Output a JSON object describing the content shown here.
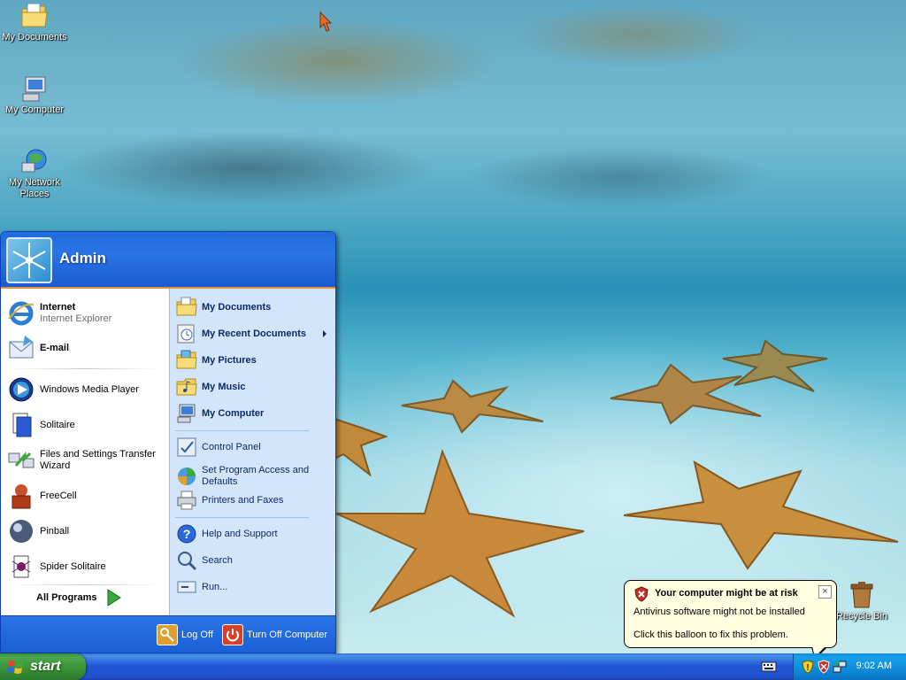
{
  "desktop": {
    "icons": [
      {
        "label": "My Documents",
        "icon": "folder-documents-icon"
      },
      {
        "label": "My Computer",
        "icon": "computer-icon"
      },
      {
        "label": "My Network Places",
        "icon": "network-places-icon"
      },
      {
        "label": "Recycle Bin",
        "icon": "recycle-bin-icon"
      }
    ]
  },
  "start_menu": {
    "username": "Admin",
    "pinned": [
      {
        "title": "Internet",
        "subtitle": "Internet Explorer",
        "icon": "internet-explorer-icon"
      },
      {
        "title": "E-mail",
        "subtitle": "",
        "icon": "email-icon"
      }
    ],
    "recent": [
      {
        "label": "Windows Media Player",
        "icon": "media-player-icon"
      },
      {
        "label": "Solitaire",
        "icon": "solitaire-icon"
      },
      {
        "label": "Files and Settings Transfer Wizard",
        "icon": "transfer-wizard-icon"
      },
      {
        "label": "FreeCell",
        "icon": "freecell-icon"
      },
      {
        "label": "Pinball",
        "icon": "pinball-icon"
      },
      {
        "label": "Spider Solitaire",
        "icon": "spider-solitaire-icon"
      }
    ],
    "all_programs": "All Programs",
    "places": [
      {
        "label": "My Documents",
        "icon": "folder-documents-icon"
      },
      {
        "label": "My Recent Documents",
        "icon": "recent-documents-icon"
      },
      {
        "label": "My Pictures",
        "icon": "folder-pictures-icon"
      },
      {
        "label": "My Music",
        "icon": "folder-music-icon"
      },
      {
        "label": "My Computer",
        "icon": "computer-icon"
      }
    ],
    "system": [
      {
        "label": "Control Panel",
        "icon": "control-panel-icon"
      },
      {
        "label": "Set Program Access and Defaults",
        "icon": "program-access-icon"
      },
      {
        "label": "Printers and Faxes",
        "icon": "printer-icon"
      }
    ],
    "help": [
      {
        "label": "Help and Support",
        "icon": "help-icon"
      },
      {
        "label": "Search",
        "icon": "search-icon"
      },
      {
        "label": "Run...",
        "icon": "run-icon"
      }
    ],
    "log_off": "Log Off",
    "turn_off": "Turn Off Computer"
  },
  "taskbar": {
    "start_label": "start",
    "clock": "9:02 AM"
  },
  "balloon": {
    "title": "Your computer might be at risk",
    "line1": "Antivirus software might not be installed",
    "line2": "Click this balloon to fix this problem.",
    "close": "×"
  },
  "colors": {
    "taskbar_blue": "#2157d7",
    "start_green": "#378f37",
    "balloon_bg": "#ffffe1",
    "menu_right_pane": "#d3e5fa"
  }
}
